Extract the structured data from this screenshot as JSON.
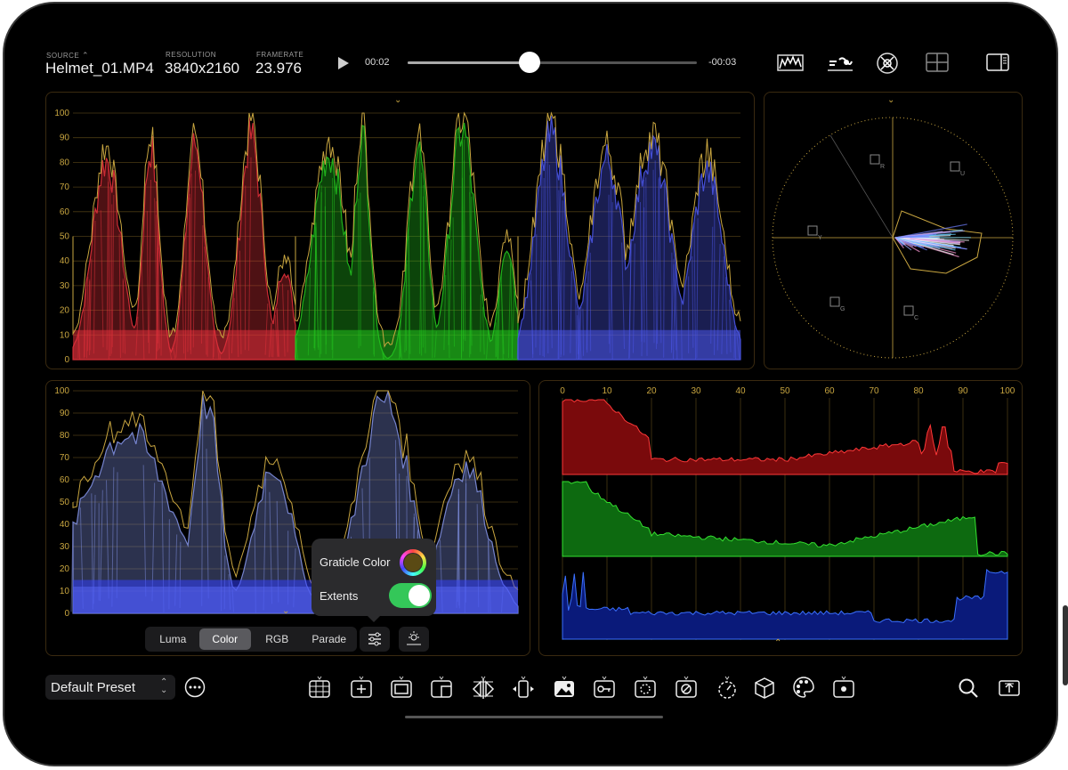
{
  "header": {
    "source_label": "SOURCE",
    "source_value": "Helmet_01.MP4",
    "resolution_label": "RESOLUTION",
    "resolution_value": "3840x2160",
    "framerate_label": "FRAMERATE",
    "framerate_value": "23.976",
    "time_elapsed": "00:02",
    "time_remaining": "-00:03",
    "scrub_progress": 0.42
  },
  "waveform_ticks": [
    "100",
    "90",
    "80",
    "70",
    "60",
    "50",
    "40",
    "30",
    "20",
    "10",
    "0"
  ],
  "histogram_ticks": [
    "0",
    "10",
    "20",
    "30",
    "40",
    "50",
    "60",
    "70",
    "80",
    "90",
    "100"
  ],
  "vectorscope_targets": [
    "R",
    "U",
    "Y",
    "G",
    "C"
  ],
  "mode_segment": {
    "options": [
      "Luma",
      "Color",
      "RGB",
      "Parade"
    ],
    "selected": "Color"
  },
  "popover": {
    "graticule_label": "Graticle Color",
    "extents_label": "Extents",
    "extents_on": true
  },
  "footer": {
    "preset_label": "Default Preset"
  },
  "icons": [
    "play-icon",
    "waveform-view-icon",
    "parade-view-icon",
    "vectorscope-view-icon",
    "layout-grid-icon",
    "sidebar-icon",
    "more-icon",
    "grid-overlay-icon",
    "add-icon",
    "frame-icon",
    "crop-icon",
    "flip-icon",
    "split-icon",
    "image-icon",
    "key-icon",
    "zoom-icon",
    "disable-icon",
    "timer-icon",
    "cube-icon",
    "palette-icon",
    "focus-icon",
    "search-icon",
    "share-icon"
  ],
  "colors": {
    "graticule": "#c9a640",
    "accent_toggle": "#34c759",
    "red": "#e0303a",
    "green": "#22c21e",
    "blue": "#4a55e8"
  }
}
